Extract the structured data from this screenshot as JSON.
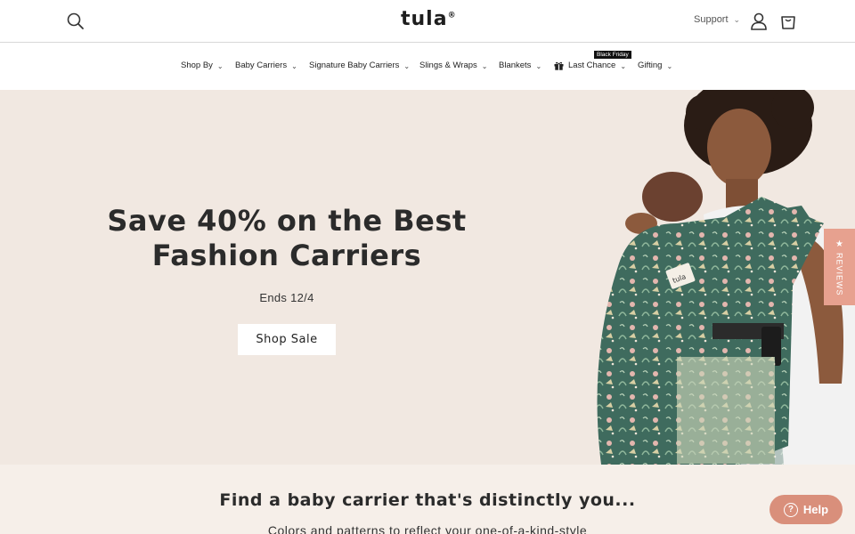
{
  "header": {
    "logo": "tula",
    "logo_mark": "®",
    "support_label": "Support",
    "icons": {
      "search": "search-icon",
      "account": "account-icon",
      "cart": "cart-icon"
    }
  },
  "nav": {
    "items": [
      {
        "label": "Shop By"
      },
      {
        "label": "Baby Carriers"
      },
      {
        "label": "Signature Baby Carriers"
      },
      {
        "label": "Slings & Wraps"
      },
      {
        "label": "Blankets"
      },
      {
        "label": "Last Chance",
        "badge": "Black Friday",
        "icon": "gift-icon"
      },
      {
        "label": "Gifting"
      }
    ]
  },
  "hero": {
    "title": "Save 40% on the Best Fashion Carriers",
    "subtitle": "Ends 12/4",
    "cta_label": "Shop Sale",
    "image_alt": "Woman wearing a baby in a patterned green dinosaur print carrier",
    "carrier_tag": "tula"
  },
  "reviews_tab": {
    "star": "★",
    "label": "REVIEWS"
  },
  "lower": {
    "title": "Find a baby carrier that's distinctly you...",
    "subtitle": "Colors and patterns to reflect your one-of-a-kind-style"
  },
  "help": {
    "label": "Help",
    "icon": "help-icon"
  },
  "colors": {
    "hero_bg": "#f1e8e1",
    "reviews_tab": "#e7a18f",
    "help_button": "#d98f7b",
    "carrier_green": "#3f6b5e"
  }
}
